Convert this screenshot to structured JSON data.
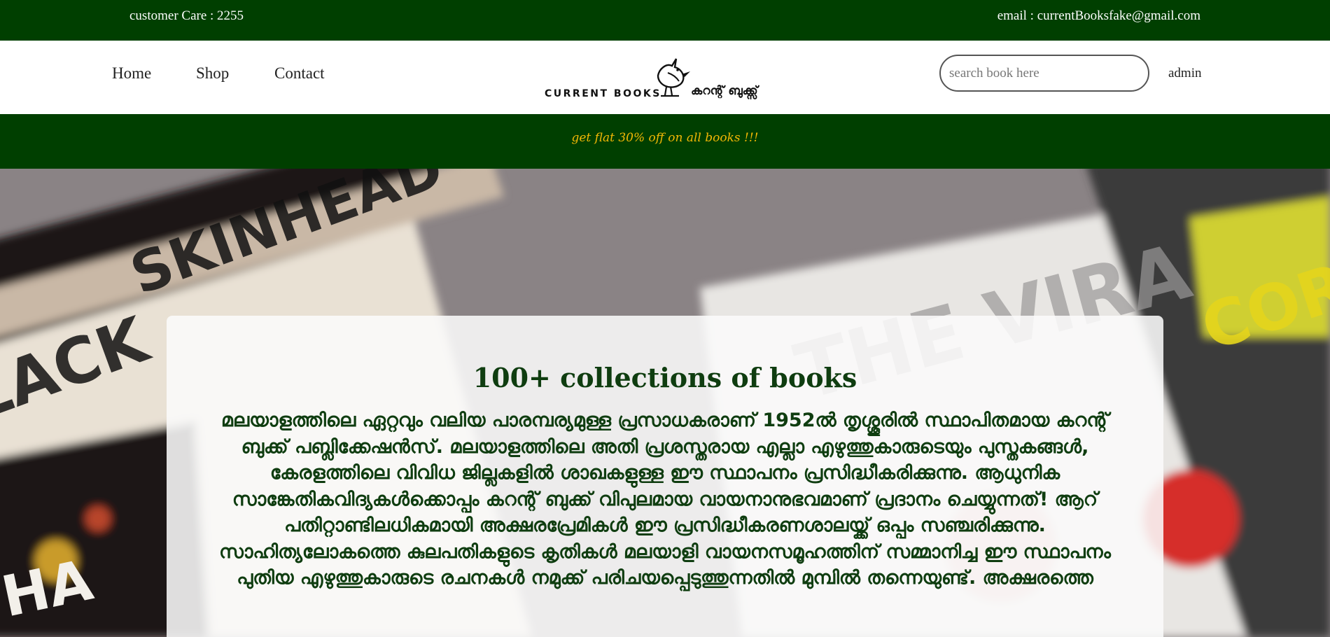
{
  "topbar": {
    "customer_care": "customer Care : 2255",
    "email": "email : currentBooksfake@gmail.com"
  },
  "nav": {
    "home": "Home",
    "shop": "Shop",
    "contact": "Contact"
  },
  "logo": {
    "english": "CURRENT BOOKS",
    "malayalam": "കറന്റ് ബുക്ക്സ്"
  },
  "search": {
    "placeholder": "search book here"
  },
  "admin_label": "admin",
  "promo": "get flat 30% off on all books !!!",
  "hero": {
    "title": "100+ collections of books",
    "description": "മലയാളത്തിലെ ഏറ്റവും വലിയ പാരമ്പര്യമുള്ള പ്രസാധകരാണ് 1952ൽ തൃശ്ശൂരിൽ സ്ഥാപിതമായ കറന്റ് ബുക്ക് പബ്ലിക്കേഷൻസ്. മലയാളത്തിലെ അതി പ്രശസ്തരായ എല്ലാ എഴുത്തുകാരുടെയും പുസ്തകങ്ങൾ, കേരളത്തിലെ വിവിധ ജില്ലകളിൽ ശാഖകളുള്ള ഈ സ്ഥാപനം പ്രസിദ്ധീകരിക്കുന്നു. ആധുനിക സാങ്കേതികവിദ്യകൾക്കൊപ്പം കറന്റ് ബുക്ക് വിപുലമായ വായനാനുഭവമാണ് പ്രദാനം ചെയ്യുന്നത്! ആറ് പതിറ്റാണ്ടിലധികമായി അക്ഷരപ്രേമികൾ ഈ പ്രസിദ്ധീകരണശാലയ്ക്ക് ഒപ്പം സഞ്ചരിക്കുന്നു. സാഹിത്യലോകത്തെ കുലപതികളുടെ കൃതികൾ മലയാളി വായനസമൂഹത്തിന് സമ്മാനിച്ച ഈ സ്ഥാപനം പുതിയ എഴുത്തുകാരുടെ രചനകൾ നമുക്ക് പരിചയപ്പെടുത്തുന്നതിൽ മുമ്പിൽ തന്നെയുണ്ട്. അക്ഷരത്തെ"
  },
  "colors": {
    "dark_green": "#003f00",
    "promo_yellow": "#f2b705",
    "title_green": "#0f3d10"
  }
}
